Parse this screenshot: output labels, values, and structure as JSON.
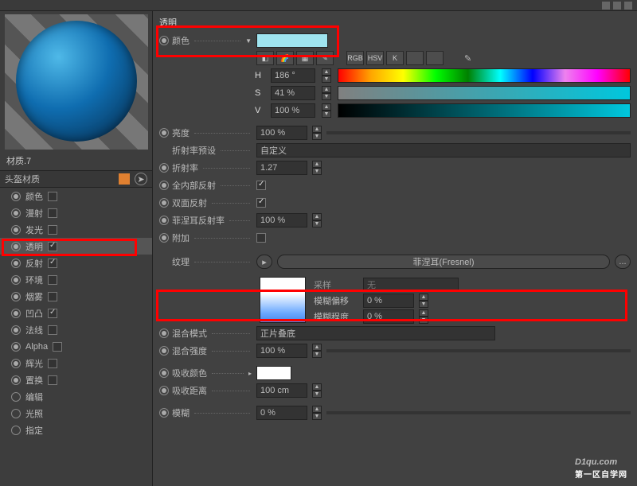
{
  "topbar": {
    "back_icon": "◀"
  },
  "sidebar": {
    "material_name": "材质.7",
    "header": "头盔材质",
    "channels": [
      {
        "label": "颜色",
        "checked": false
      },
      {
        "label": "漫射",
        "checked": false
      },
      {
        "label": "发光",
        "checked": false
      },
      {
        "label": "透明",
        "checked": true,
        "selected": true
      },
      {
        "label": "反射",
        "checked": true
      },
      {
        "label": "环境",
        "checked": false
      },
      {
        "label": "烟雾",
        "checked": false
      },
      {
        "label": "凹凸",
        "checked": true
      },
      {
        "label": "法线",
        "checked": false
      },
      {
        "label": "Alpha",
        "checked": false
      },
      {
        "label": "辉光",
        "checked": false
      },
      {
        "label": "置换",
        "checked": false
      },
      {
        "label": "编辑",
        "checked": null
      },
      {
        "label": "光照",
        "checked": null
      },
      {
        "label": "指定",
        "checked": null
      }
    ]
  },
  "panel": {
    "title": "透明",
    "color_label": "颜色",
    "hsv": {
      "h_label": "H",
      "h_value": "186 °",
      "s_label": "S",
      "s_value": "41 %",
      "v_label": "V",
      "v_value": "100 %"
    },
    "mode_buttons": [
      "RGB",
      "HSV",
      "K"
    ],
    "brightness": {
      "label": "亮度",
      "value": "100 %"
    },
    "ior_preset": {
      "label": "折射率预设",
      "value": "自定义"
    },
    "ior": {
      "label": "折射率",
      "value": "1.27"
    },
    "total_internal": {
      "label": "全内部反射",
      "checked": true
    },
    "double_sided": {
      "label": "双面反射",
      "checked": true
    },
    "fresnel_refl": {
      "label": "菲涅耳反射率",
      "value": "100 %"
    },
    "additive": {
      "label": "附加",
      "checked": false
    },
    "texture": {
      "label": "纹理",
      "value": "菲涅耳(Fresnel)",
      "more": "..."
    },
    "sampling": {
      "label": "采样",
      "value": "无"
    },
    "blur_offset": {
      "label": "模糊偏移",
      "value": "0 %"
    },
    "blur_scale": {
      "label": "模糊程度",
      "value": "0 %"
    },
    "blend_mode": {
      "label": "混合模式",
      "value": "正片叠底"
    },
    "blend_strength": {
      "label": "混合强度",
      "value": "100 %"
    },
    "absorb_color": {
      "label": "吸收颜色"
    },
    "absorb_dist": {
      "label": "吸收距离",
      "value": "100 cm"
    },
    "blur": {
      "label": "模糊",
      "value": "0 %"
    }
  },
  "watermark": {
    "main": "D1qu.com",
    "sub": "第一区自学网"
  }
}
